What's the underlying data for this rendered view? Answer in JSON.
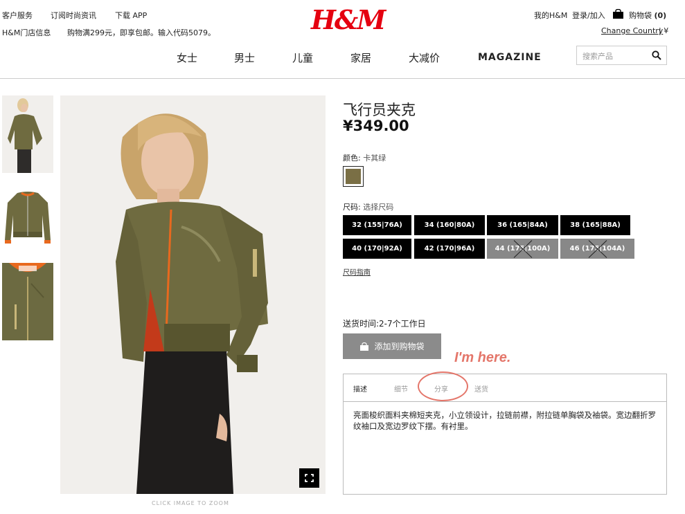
{
  "header": {
    "top_left": [
      "客户服务",
      "订阅时尚资讯",
      "下载 APP"
    ],
    "store_info": "H&M门店信息",
    "promo": "购物满299元，即享包邮。输入代码5079。",
    "logo": "H&M",
    "my_hm": "我的H&M",
    "login": "登录/加入",
    "bag_label": "购物袋",
    "bag_count": "(0)",
    "change_country": "Change Country",
    "currency": "| ¥"
  },
  "nav": {
    "items": [
      "女士",
      "男士",
      "儿童",
      "家居",
      "大减价",
      "MAGAZINE"
    ]
  },
  "search": {
    "placeholder": "搜索产品"
  },
  "gallery": {
    "zoom_caption": "CLICK IMAGE TO ZOOM"
  },
  "product": {
    "title": "飞行员夹克",
    "price": "¥349.00",
    "color_label": "颜色:",
    "color_value": "卡其绿",
    "size_label": "尺码:",
    "size_value": "选择尺码",
    "sizes": [
      {
        "label": "32 (155|76A)",
        "available": true
      },
      {
        "label": "34 (160|80A)",
        "available": true
      },
      {
        "label": "36 (165|84A)",
        "available": true
      },
      {
        "label": "38 (165|88A)",
        "available": true
      },
      {
        "label": "40 (170|92A)",
        "available": true
      },
      {
        "label": "42 (170|96A)",
        "available": true
      },
      {
        "label": "44 (175|100A)",
        "available": false
      },
      {
        "label": "46 (175|104A)",
        "available": false
      }
    ],
    "size_guide": "尺码指南",
    "delivery": "送货时间:2-7个工作日",
    "add_to_bag": "添加到购物袋",
    "swatch_color": "#7a6f45"
  },
  "annotation": {
    "text": "I'm here.",
    "color": "#e4766a"
  },
  "tabs": {
    "items": [
      "描述",
      "细节",
      "分享",
      "送货"
    ],
    "description": "亮面梭织面料夹棉短夹克，小立领设计，拉链前襟，附拉链单胸袋及袖袋。宽边翻折罗纹袖口及宽边罗纹下摆。有衬里。"
  }
}
